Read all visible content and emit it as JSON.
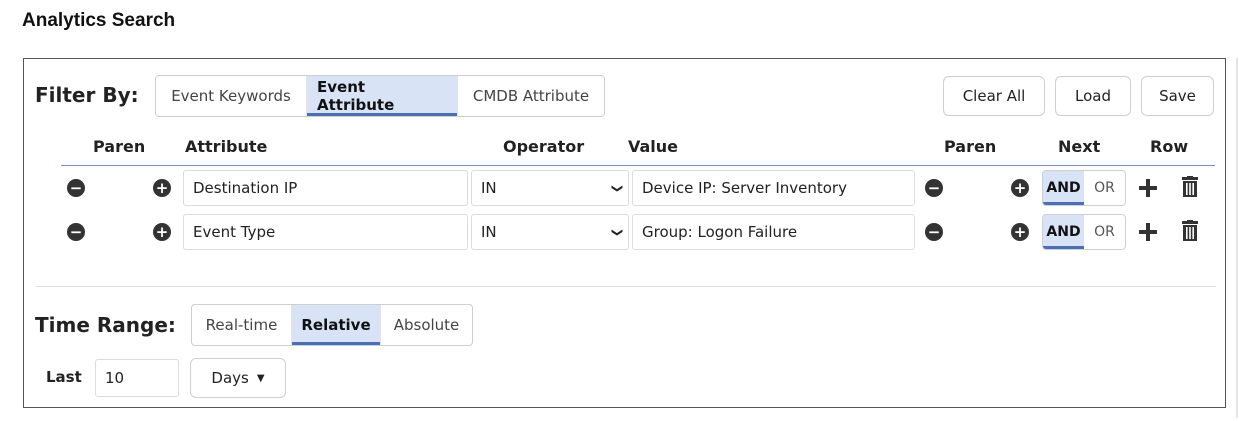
{
  "page_title": "Analytics Search",
  "filter": {
    "label": "Filter By:",
    "tabs": [
      {
        "label": "Event Keywords",
        "active": false
      },
      {
        "label": "Event Attribute",
        "active": true
      },
      {
        "label": "CMDB Attribute",
        "active": false
      }
    ],
    "actions": {
      "clear_all": "Clear All",
      "load": "Load",
      "save": "Save"
    },
    "columns": {
      "paren_open": "Paren",
      "attribute": "Attribute",
      "operator": "Operator",
      "value": "Value",
      "paren_close": "Paren",
      "next": "Next",
      "row": "Row"
    },
    "rows": [
      {
        "attribute": "Destination IP",
        "operator": "IN",
        "value": "Device IP: Server Inventory",
        "next": {
          "and": "AND",
          "or": "OR",
          "selected": "AND"
        }
      },
      {
        "attribute": "Event Type",
        "operator": "IN",
        "value": "Group: Logon Failure",
        "next": {
          "and": "AND",
          "or": "OR",
          "selected": "AND"
        }
      }
    ]
  },
  "time_range": {
    "label": "Time Range:",
    "tabs": [
      {
        "label": "Real-time",
        "active": false
      },
      {
        "label": "Relative",
        "active": true
      },
      {
        "label": "Absolute",
        "active": false
      }
    ],
    "last_label": "Last",
    "last_value": "10",
    "unit": "Days"
  },
  "icons": {
    "minus": "minus-circle-icon",
    "plus": "plus-circle-icon",
    "add_row": "plus-icon",
    "delete_row": "trash-icon",
    "dropdown": "chevron-down-icon",
    "caret": "caret-down-icon"
  },
  "colors": {
    "active_tab_bg": "#d9e3f6",
    "active_tab_underline": "#4a6fb5",
    "icon_dark": "#333333"
  }
}
